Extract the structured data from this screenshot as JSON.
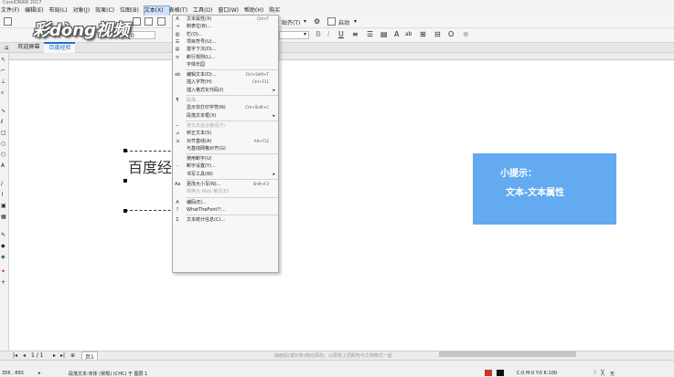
{
  "title_bar": "CorelDRAW 2017",
  "menus": [
    "文件(F)",
    "编辑(E)",
    "布局(L)",
    "对象(J)",
    "效果(C)",
    "位图(B)",
    "文本(X)",
    "表格(T)",
    "工具(O)",
    "窗口(W)",
    "帮助(H)",
    "购买"
  ],
  "active_menu_index": 6,
  "toolbar": {
    "paste_label": "贴齐(T)",
    "launch_label": "启动",
    "coord_value": "0"
  },
  "tabs": {
    "welcome": "欢迎屏幕",
    "doc": "百度经验"
  },
  "watermark": "彩dòng视频",
  "canvas": {
    "text": "百度经"
  },
  "tip": {
    "title": "小提示：",
    "body": "文本-文本属性"
  },
  "dropdown": [
    {
      "label": "文本属性(X)",
      "shortcut": "Ctrl+T",
      "icon": "text-props-icon"
    },
    {
      "label": "制表位(B)...",
      "icon": "tab-stops-icon"
    },
    {
      "label": "栏(O)...",
      "icon": "columns-icon"
    },
    {
      "label": "项目符号(U)...",
      "icon": "bullets-icon"
    },
    {
      "label": "首字下沉(D)...",
      "icon": "drop-cap-icon"
    },
    {
      "label": "断行规则(L)...",
      "icon": "line-break-icon"
    },
    {
      "label": "字体乐园",
      "icon": ""
    },
    {
      "sep": true
    },
    {
      "label": "编辑文本(D)...",
      "shortcut": "Ctrl+Shift+T",
      "icon": "edit-text-icon"
    },
    {
      "label": "插入字符(H)",
      "shortcut": "Ctrl+F11",
      "icon": ""
    },
    {
      "label": "插入格式化代码(I)",
      "submenu": true,
      "icon": ""
    },
    {
      "sep": true
    },
    {
      "label": "段落...",
      "disabled": true,
      "icon": "paragraph-icon"
    },
    {
      "label": "显示非打印字符(N)",
      "shortcut": "Ctrl+Shift+C",
      "icon": ""
    },
    {
      "label": "段落文本框(X)",
      "submenu": true,
      "icon": ""
    },
    {
      "sep": true
    },
    {
      "label": "使文本适合路径(T)",
      "disabled": true,
      "icon": "fit-path-icon"
    },
    {
      "label": "矫正文本(S)",
      "icon": "straighten-icon"
    },
    {
      "label": "对齐基线(A)",
      "shortcut": "Alt+F12",
      "icon": "align-baseline-icon"
    },
    {
      "label": "与基线网格对齐(G)",
      "icon": ""
    },
    {
      "sep": true
    },
    {
      "label": "使用断字(U)",
      "icon": ""
    },
    {
      "label": "断字设置(Y)...",
      "icon": "hyphen-icon"
    },
    {
      "label": "书写工具(W)",
      "submenu": true,
      "icon": ""
    },
    {
      "sep": true
    },
    {
      "label": "更改大小写(N)...",
      "shortcut": "Shift+F3",
      "icon": "change-case-icon"
    },
    {
      "label": "转换为 Web 格式(E)",
      "disabled": true,
      "icon": ""
    },
    {
      "sep": true
    },
    {
      "label": "编码(E)...",
      "icon": "encoding-icon"
    },
    {
      "label": "WhatTheFont?!...",
      "icon": "whatthefont-icon"
    },
    {
      "sep": true
    },
    {
      "label": "文本统计信息(C)...",
      "icon": "stats-icon"
    }
  ],
  "pagebar": {
    "page_info": "1 / 1",
    "page_tab": "页1",
    "hint": "曲面贴(或对象)拖动添加。以便将上把颜色与文档格式一起"
  },
  "status": {
    "coords": "356 , 893",
    "object_info": "段落文本:宋体 (常规) (CHC) 于 图层 1",
    "color_info": "C:0 M:0 Y:0 K:100",
    "fill_info": "无"
  },
  "colors": {
    "tip_bg": "#63aaf0",
    "menu_highlight": "#cfe3f8"
  }
}
